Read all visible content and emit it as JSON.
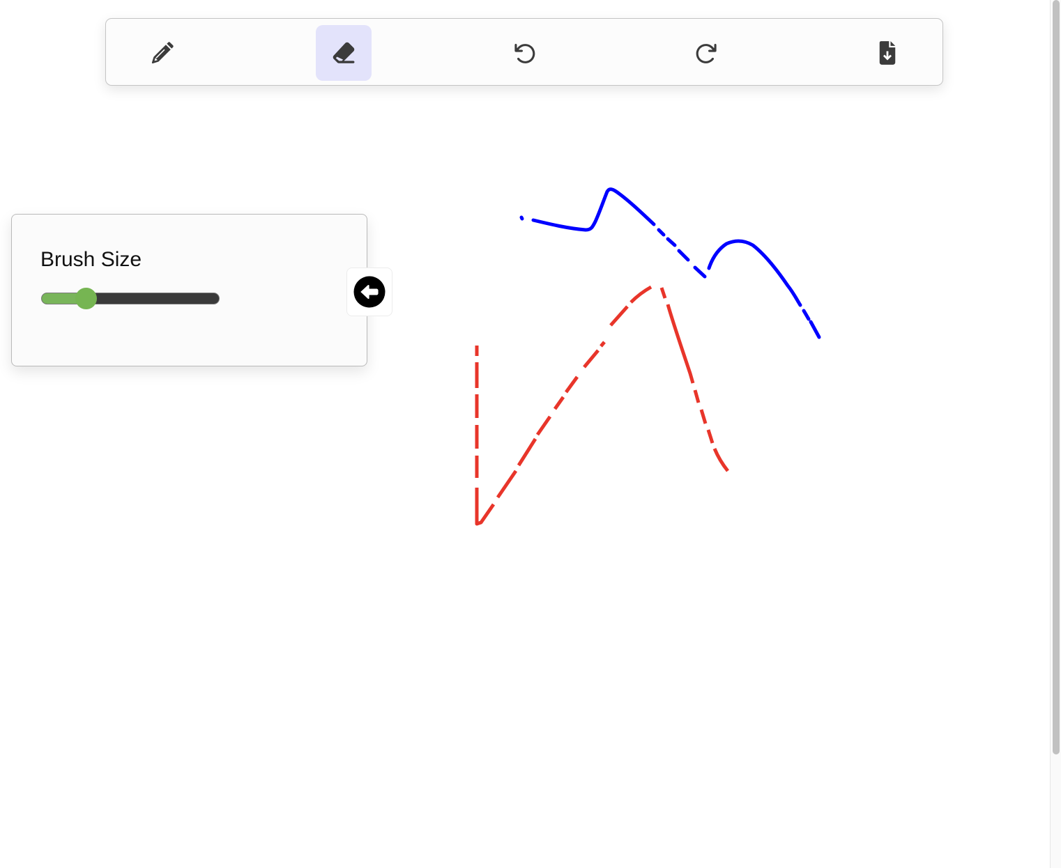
{
  "toolbar": {
    "tools": [
      {
        "name": "pencil",
        "icon": "pencil-icon",
        "active": false
      },
      {
        "name": "eraser",
        "icon": "eraser-icon",
        "active": true
      },
      {
        "name": "undo",
        "icon": "undo-icon",
        "active": false
      },
      {
        "name": "redo",
        "icon": "redo-icon",
        "active": false
      },
      {
        "name": "save",
        "icon": "file-download-icon",
        "active": false
      }
    ],
    "active_color": "#e3e3fb"
  },
  "brush_panel": {
    "title": "Brush Size",
    "slider_value_fraction": 0.25,
    "slider_fill_color": "#79b55a",
    "collapse_icon": "arrow-circle-left-icon"
  },
  "strokes": {
    "blue_color": "#0000ff",
    "red_color": "#e8352a"
  }
}
